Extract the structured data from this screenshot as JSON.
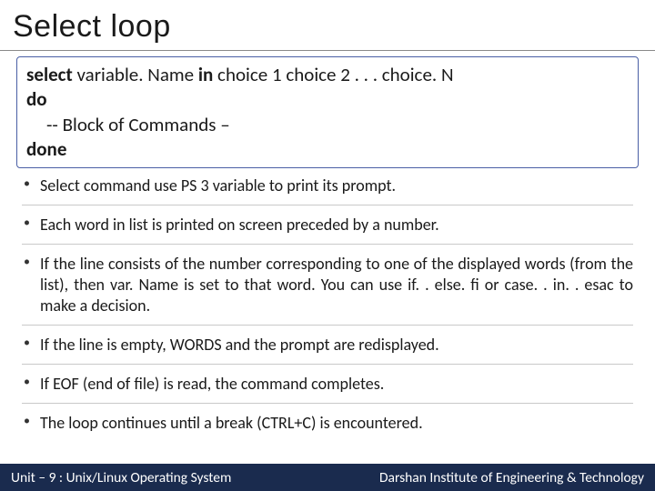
{
  "title": "Select loop",
  "code": {
    "line1_kw1": "select",
    "line1_mid": " variable. Name ",
    "line1_kw2": "in",
    "line1_rest": " choice 1 choice 2 . . . choice. N",
    "line2": "do",
    "line3": "-- Block of Commands –",
    "line4": "done"
  },
  "bullets": [
    "Select command use PS 3 variable to print its prompt.",
    "Each word in list is printed on screen preceded by a number.",
    "If the line consists of the number corresponding to one of the displayed words (from the list), then var. Name is set to that word. You can use if. . else. fi or case. . in. . esac to make a decision.",
    "If the line is empty, WORDS and the prompt are redisplayed.",
    "If EOF (end of file) is read, the command completes.",
    "The loop continues until a break (CTRL+C) is encountered."
  ],
  "footer": {
    "left": "Unit – 9  : Unix/Linux Operating System",
    "right": "Darshan Institute of Engineering & Technology"
  }
}
